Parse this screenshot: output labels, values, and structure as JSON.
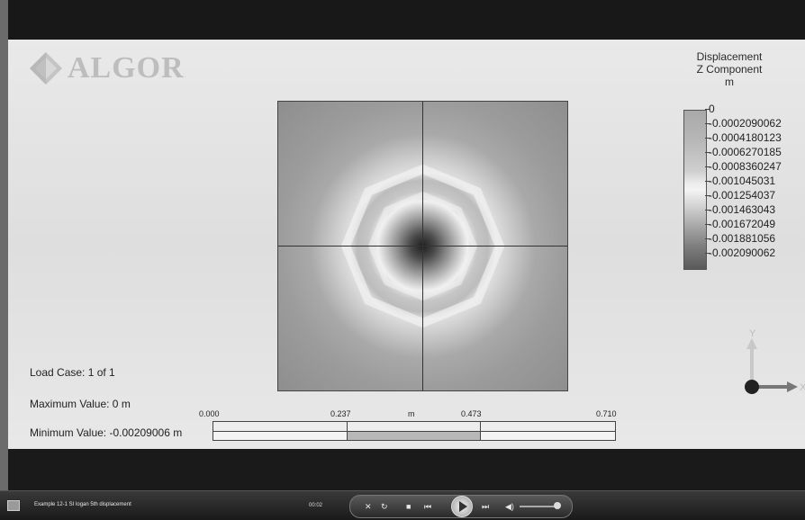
{
  "logo": {
    "text": "ALGOR",
    "dot": "."
  },
  "legend": {
    "title_line1": "Displacement",
    "title_line2": "Z Component",
    "units": "m",
    "labels": [
      "0",
      "-0.0002090062",
      "-0.0004180123",
      "-0.0006270185",
      "-0.0008360247",
      "-0.001045031",
      "-0.001254037",
      "-0.001463043",
      "-0.001672049",
      "-0.001881056",
      "-0.002090062"
    ]
  },
  "info": {
    "load_case": "Load Case:  1 of 1",
    "max_value": "Maximum Value: 0 m",
    "min_value": "Minimum Value: -0.00209006 m"
  },
  "scale": {
    "ticks": [
      "0.000",
      "0.237",
      "m",
      "0.473",
      "0.710"
    ]
  },
  "axis": {
    "y_label": "Y",
    "x_label": "X"
  },
  "player": {
    "title": "Example 12-1 SI logan 5th displacement",
    "time": "00:02"
  },
  "icons": {
    "logo": "algor-diamond-logo",
    "shuffle": "shuffle-icon",
    "repeat": "repeat-icon",
    "stop": "stop-icon",
    "prev": "previous-icon",
    "play": "play-icon",
    "next": "next-icon",
    "volume": "volume-icon"
  }
}
